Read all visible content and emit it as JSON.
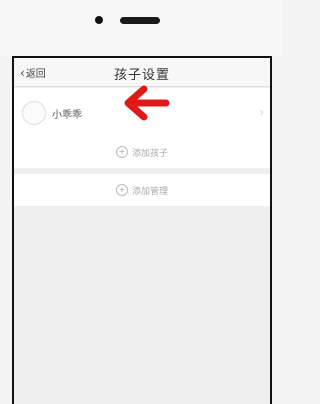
{
  "nav": {
    "back_label": "返回",
    "title": "孩子设置"
  },
  "children": [
    {
      "name": "小乖乖"
    }
  ],
  "actions": {
    "add_child": "添加孩子",
    "add_guardian": "添加管理"
  },
  "colors": {
    "arrow": "#e01818"
  }
}
